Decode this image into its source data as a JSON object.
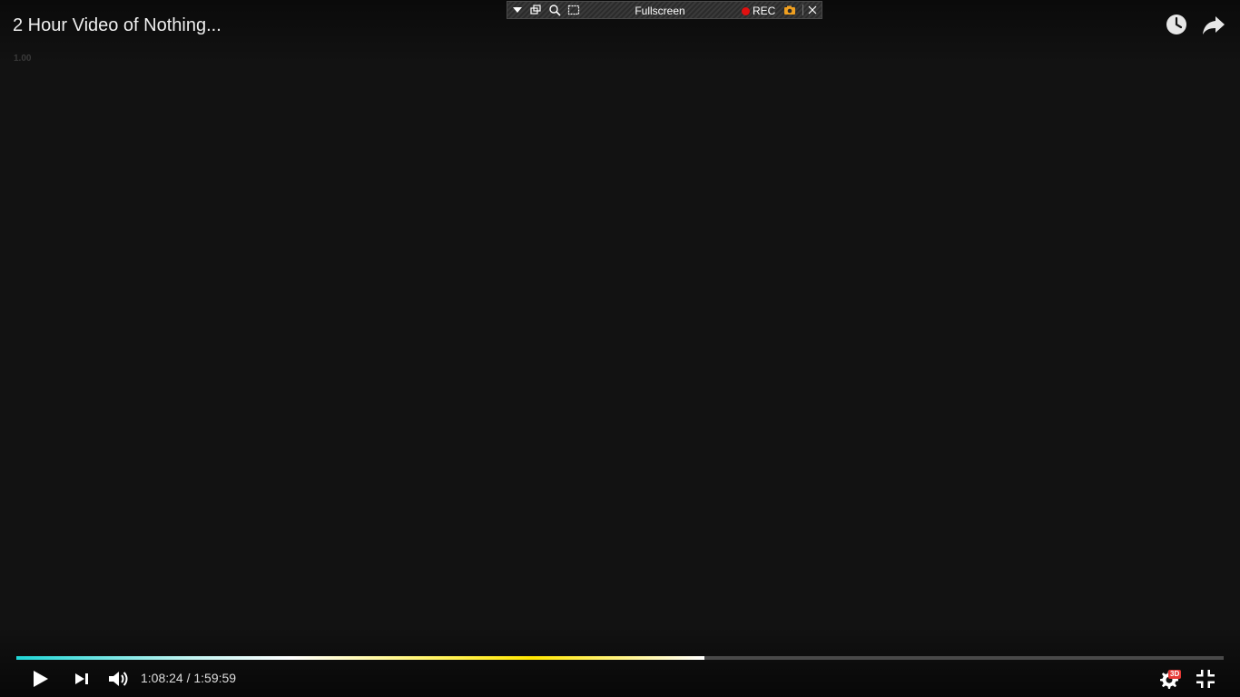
{
  "video": {
    "title": "2 Hour Video of Nothing...",
    "speed_label": "1.00"
  },
  "toolbar": {
    "title": "Fullscreen",
    "rec_label": "REC",
    "icons": [
      "dropdown-arrow-icon",
      "restore-window-icon",
      "zoom-icon",
      "screen-select-icon",
      "record-dot-icon",
      "camera-icon",
      "close-icon"
    ]
  },
  "top_actions": {
    "icons": [
      "watch-later-icon",
      "share-icon"
    ]
  },
  "controls": {
    "current_time": "1:08:24",
    "separator": "/",
    "duration": "1:59:59",
    "time_display": "1:08:24 / 1:59:59",
    "progress_fraction": 0.57,
    "badge_3d": "3D",
    "icons": [
      "play-icon",
      "next-icon",
      "volume-icon",
      "settings-icon",
      "exit-fullscreen-icon"
    ]
  },
  "colors": {
    "background": "#121212",
    "progress_start": "#1fd6d6",
    "progress_mid": "#ffe600",
    "rec_dot": "#e01010",
    "badge": "#e53935"
  }
}
